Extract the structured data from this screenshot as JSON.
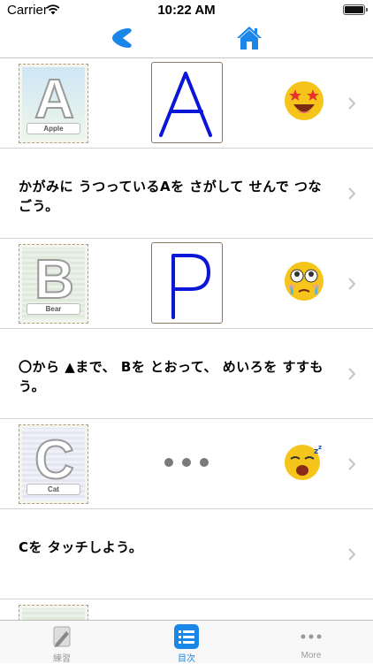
{
  "status_bar": {
    "carrier": "Carrier",
    "time": "10:22 AM"
  },
  "colors": {
    "accent": "#1a86e8",
    "drawn_letter": "#0a16d8",
    "separator": "#d3d3d3"
  },
  "rows": [
    {
      "type": "letter",
      "card_letter": "A",
      "card_word": "Apple",
      "drawn_letter": "A",
      "emoji": "star-eyes-emoji"
    },
    {
      "type": "instruction",
      "text": "かがみに うつっているAを さがして せんで つなごう。"
    },
    {
      "type": "letter",
      "card_letter": "B",
      "card_word": "Bear",
      "drawn_letter": "P",
      "emoji": "worried-emoji"
    },
    {
      "type": "instruction",
      "text": "〇から ▲まで、 Bを とおって、 めいろを すすもう。"
    },
    {
      "type": "letter",
      "card_letter": "C",
      "card_word": "Cat",
      "drawn_letter": "",
      "emoji": "sleepy-emoji"
    },
    {
      "type": "instruction",
      "text": "Cを タッチしよう。"
    }
  ],
  "tabs": [
    {
      "label": "練習",
      "icon": "pencil-note-icon",
      "active": false
    },
    {
      "label": "目次",
      "icon": "list-icon",
      "active": true
    },
    {
      "label": "More",
      "icon": "more-dots-icon",
      "active": false
    }
  ]
}
